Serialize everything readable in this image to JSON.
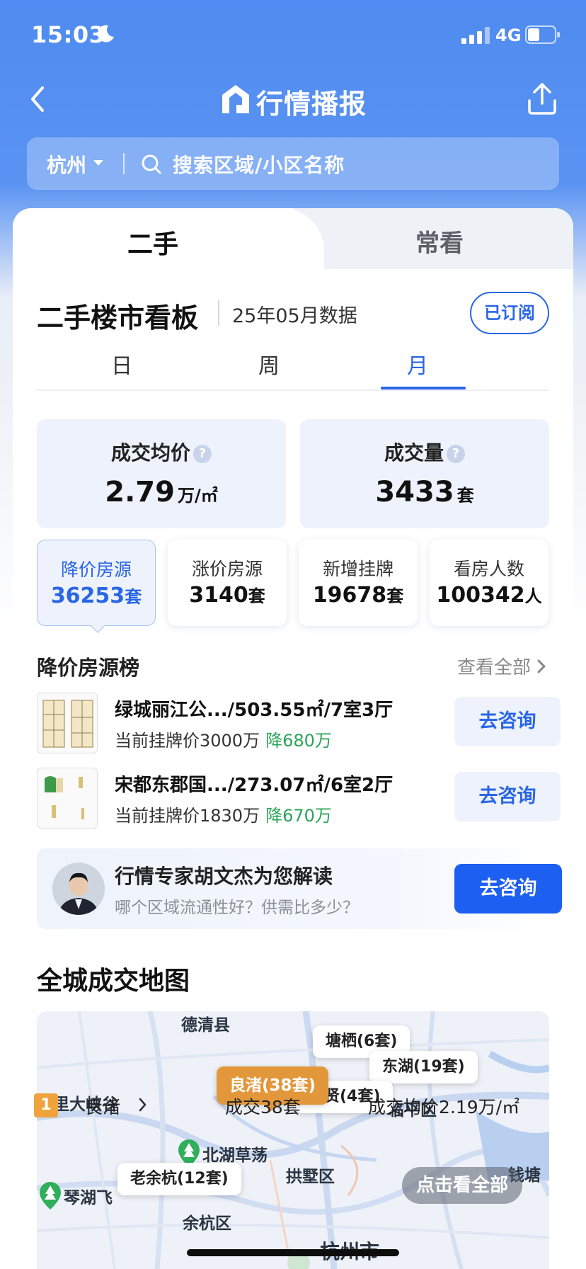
{
  "status": {
    "time": "15:03",
    "network": "4G"
  },
  "nav": {
    "title": "行情播报"
  },
  "search": {
    "city": "杭州",
    "placeholder": "搜索区域/小区名称"
  },
  "tabs": {
    "main": "二手",
    "frequent": "常看"
  },
  "board": {
    "title": "二手楼市看板",
    "date": "25年05月数据",
    "subscribe": "已订阅",
    "periods": [
      "日",
      "周",
      "月"
    ],
    "active_period": "月"
  },
  "stats": {
    "avg_price": {
      "label": "成交均价",
      "value": "2.79",
      "unit": "万/㎡"
    },
    "volume": {
      "label": "成交量",
      "value": "3433",
      "unit": "套"
    },
    "small": [
      {
        "label": "降价房源",
        "value": "36253",
        "unit": "套"
      },
      {
        "label": "涨价房源",
        "value": "3140",
        "unit": "套"
      },
      {
        "label": "新增挂牌",
        "value": "19678",
        "unit": "套"
      },
      {
        "label": "看房人数",
        "value": "100342",
        "unit": "人"
      }
    ]
  },
  "ranking": {
    "title": "降价房源榜",
    "see_all": "查看全部",
    "items": [
      {
        "name": "绿城丽江公.../503.55㎡/7室3厅",
        "price": "当前挂牌价3000万",
        "drop": "降680万",
        "button": "去咨询"
      },
      {
        "name": "宋都东郡国.../273.07㎡/6室2厅",
        "price": "当前挂牌价1830万",
        "drop": "降670万",
        "button": "去咨询"
      }
    ]
  },
  "expert": {
    "title": "行情专家胡文杰为您解读",
    "subtitle": "哪个区域流通性好？供需比多少？",
    "button": "去咨询"
  },
  "map": {
    "title": "全城成交地图",
    "place_labels": [
      "德清县",
      "空里大峡谷",
      "北湖草荡",
      "临平区",
      "拱墅区",
      "钱塘",
      "琴湖飞",
      "余杭区",
      "杭州市"
    ],
    "pins": [
      {
        "label": "塘栖(6套)"
      },
      {
        "label": "东湖(19套)"
      },
      {
        "label": "良渚(38套)"
      },
      {
        "label": "崇贤(4套)"
      },
      {
        "label": "老余杭(12套)"
      }
    ],
    "see_all": "点击看全部"
  },
  "bottom_row": {
    "rank": "1",
    "area": "良渚",
    "deals": "成交38套",
    "avg": "成交均价2.19万/㎡"
  },
  "colors": {
    "accent": "#2a66e6",
    "hot_pin": "#e3973b",
    "drop_green": "#2aa45a"
  }
}
